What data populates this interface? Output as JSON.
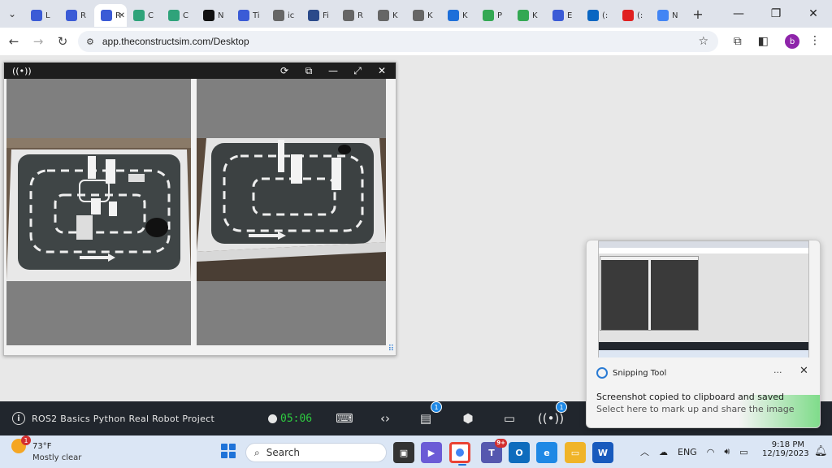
{
  "browser": {
    "tabs": [
      {
        "letter": "L",
        "color": "#3b5bd6",
        "icon": "dropbox-diamond-icon"
      },
      {
        "letter": "R",
        "color": "#3b5bd6",
        "icon": "diamond-icon"
      },
      {
        "letter": "R",
        "color": "#3b5bd6",
        "icon": "diamond-icon"
      },
      {
        "letter": "C",
        "color": "#2fa37a",
        "icon": "openai-icon"
      },
      {
        "letter": "C",
        "color": "#2fa37a",
        "icon": "openai-icon"
      },
      {
        "letter": "N",
        "color": "#111111",
        "icon": "medium-icon"
      },
      {
        "letter": "Ti",
        "color": "#3b5bd6",
        "icon": "diamond-icon"
      },
      {
        "letter": "ic",
        "color": "#666666",
        "icon": "globe-icon"
      },
      {
        "letter": "Fi",
        "color": "#2b4a8a",
        "icon": "web-icon"
      },
      {
        "letter": "R",
        "color": "#666666",
        "icon": "globe-icon"
      },
      {
        "letter": "K",
        "color": "#666666",
        "icon": "globe-icon"
      },
      {
        "letter": "K",
        "color": "#666666",
        "icon": "globe-icon"
      },
      {
        "letter": "K",
        "color": "#1e6fd9",
        "icon": "dropbox-icon"
      },
      {
        "letter": "P",
        "color": "#34a853",
        "icon": "drive-icon"
      },
      {
        "letter": "K",
        "color": "#34a853",
        "icon": "drive-icon"
      },
      {
        "letter": "E",
        "color": "#3b5bd6",
        "icon": "diamond-icon"
      },
      {
        "letter": "(:",
        "color": "#0a66c2",
        "icon": "linkedin-icon"
      },
      {
        "letter": "(:",
        "color": "#e02020",
        "icon": "youtube-icon"
      },
      {
        "letter": "N",
        "color": "#4285f4",
        "icon": "google-icon"
      }
    ],
    "active_tab_index": 2,
    "url": "app.theconstructsim.com/Desktop",
    "profile_initial": "b"
  },
  "app_bar": {
    "project_name": "ROS2 Basics Python Real Robot Project",
    "timer": "05:06",
    "notebook_badge": "1",
    "connection_badge": "1"
  },
  "toast": {
    "app_name": "Snipping Tool",
    "message": "Screenshot copied to clipboard and saved",
    "sub_message": "Select here to mark up and share the image"
  },
  "taskbar": {
    "temperature": "73°F",
    "weather": "Mostly clear",
    "weather_badge": "1",
    "search_placeholder": "Search",
    "teams_badge": "9+",
    "language": "ENG",
    "time": "9:18 PM",
    "date": "12/19/2023"
  }
}
